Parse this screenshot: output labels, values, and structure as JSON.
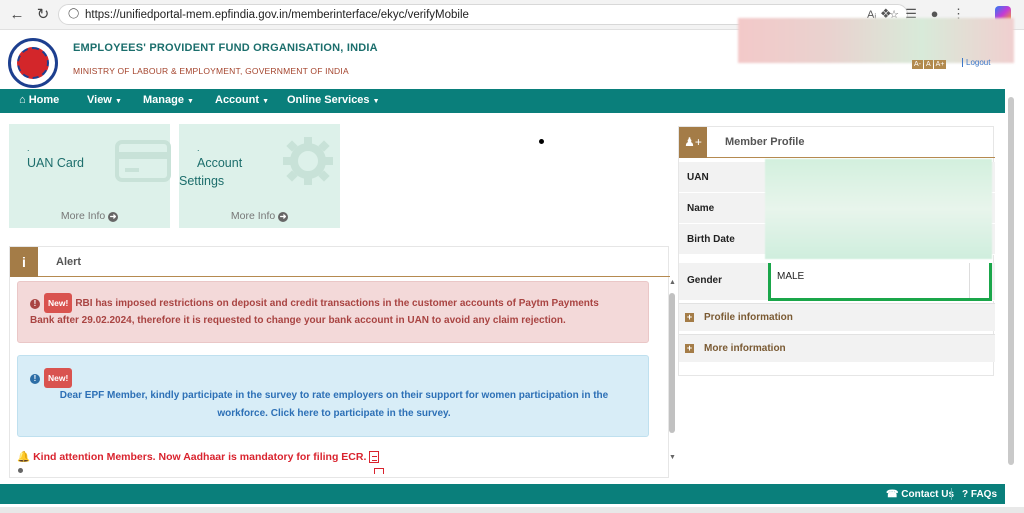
{
  "browser": {
    "url": "https://unifiedportal-mem.epfindia.gov.in/memberinterface/ekyc/verifyMobile",
    "back_icon": "arrow-left-icon",
    "reload_icon": "reload-icon"
  },
  "header": {
    "org_name": "EMPLOYEES' PROVIDENT FUND ORGANISATION, INDIA",
    "ministry": "MINISTRY OF LABOUR & EMPLOYMENT, GOVERNMENT OF INDIA",
    "font_buttons": [
      "A-",
      "A",
      "A+"
    ],
    "logout_label": "Logout"
  },
  "nav": {
    "items": [
      {
        "label": "Home"
      },
      {
        "label": "View"
      },
      {
        "label": "Manage"
      },
      {
        "label": "Account"
      },
      {
        "label": "Online Services"
      }
    ]
  },
  "cards": [
    {
      "title": "UAN Card",
      "more": "More Info",
      "icon": "credit-card-icon"
    },
    {
      "title_line1": "Account",
      "title_line2": "Settings",
      "more": "More Info",
      "icon": "gear-icon"
    }
  ],
  "alert": {
    "title": "Alert",
    "new_badge": "New!",
    "red_msg_line1": "RBI has imposed restrictions on deposit and credit transactions in the customer accounts of Paytm Payments",
    "red_msg_line2": "Bank after 29.02.2024, therefore it is requested to change your bank account in UAN to avoid any claim rejection.",
    "blue_msg_line1": "Dear EPF Member, kindly participate in the survey to rate employers on their support for women participation in the",
    "blue_msg_line2": "workforce. Click here to participate in the survey.",
    "kind_attention": "Kind attention Members. Now Aadhaar is mandatory for filing ECR."
  },
  "profile": {
    "title": "Member Profile",
    "rows": [
      {
        "label": "UAN"
      },
      {
        "label": "Name"
      },
      {
        "label": "Birth Date"
      },
      {
        "label": "Gender",
        "value": "MALE"
      }
    ],
    "accordions": [
      {
        "label": "Profile information"
      },
      {
        "label": "More information"
      }
    ]
  },
  "footer": {
    "contact": "Contact Us",
    "faqs": "FAQs"
  },
  "colors": {
    "teal": "#0a7f7b",
    "brown": "#a47c47",
    "alert_red_bg": "#f3d9d9",
    "alert_blue_bg": "#d8edf7",
    "gender_border": "#1aa64a"
  }
}
